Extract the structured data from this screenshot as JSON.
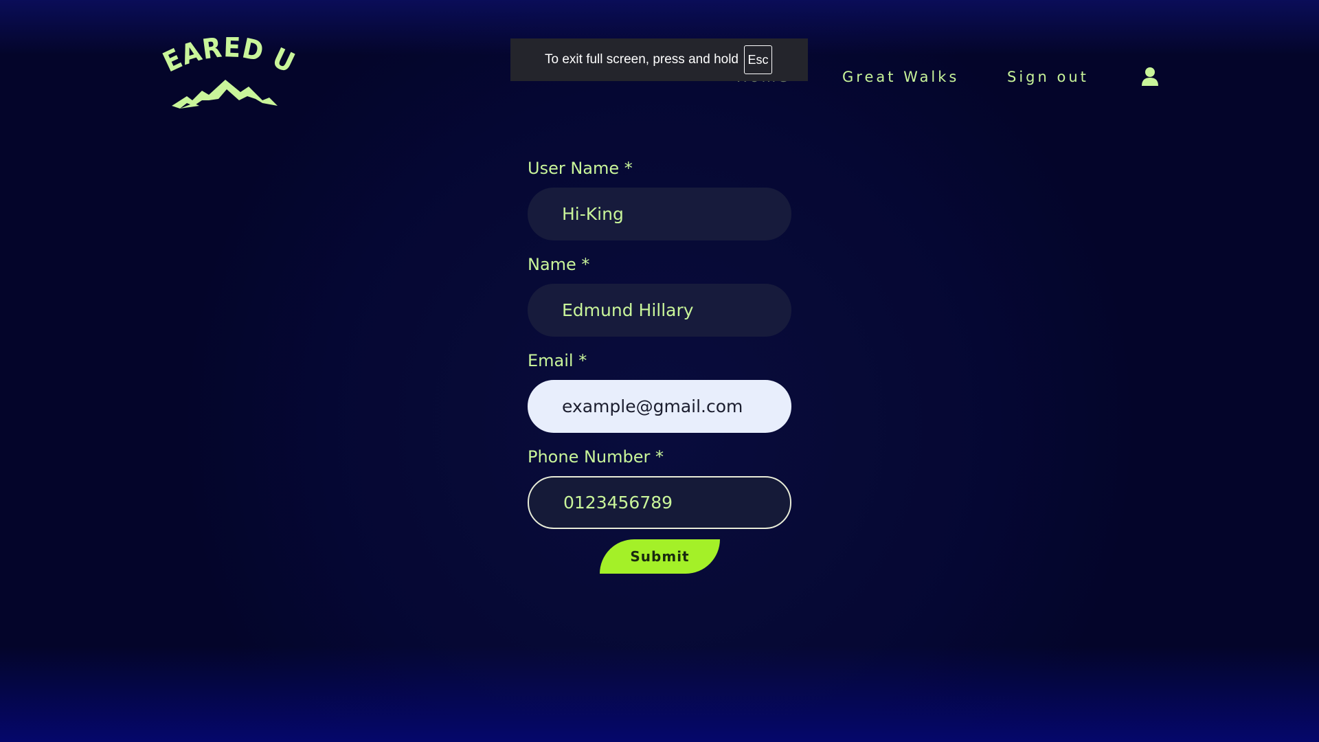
{
  "brand": {
    "logo_text": "GEARED UP",
    "accent_color": "#c9f59a"
  },
  "fullscreen_banner": {
    "message": "To exit full screen, press and hold",
    "key": "Esc"
  },
  "nav": {
    "home": "Home",
    "great_walks": "Great Walks",
    "sign_out": "Sign out",
    "user_icon": "user-icon"
  },
  "form": {
    "username": {
      "label": "User Name *",
      "value": "Hi-King"
    },
    "name": {
      "label": "Name *",
      "value": "Edmund Hillary"
    },
    "email": {
      "label": "Email *",
      "value": "example@gmail.com"
    },
    "phone": {
      "label": "Phone Number *",
      "value": "0123456789"
    },
    "submit_label": "Submit"
  },
  "colors": {
    "background": "#070a36",
    "text_accent": "#c9f59a",
    "submit_button": "#a4f028",
    "input_dark": "#171b3c",
    "input_light": "#e8eefc"
  }
}
